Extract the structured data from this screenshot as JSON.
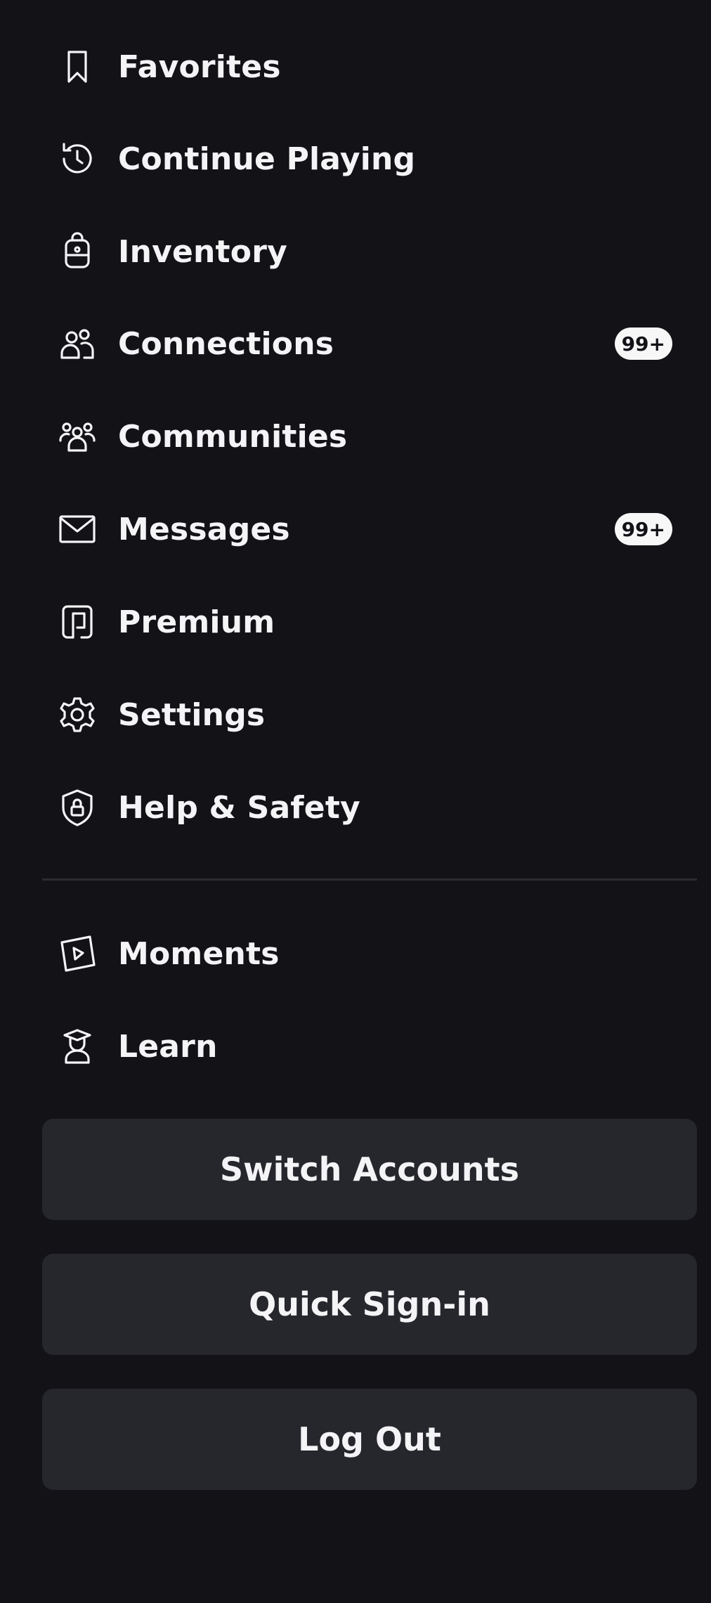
{
  "menu": {
    "items": [
      {
        "label": "Favorites",
        "icon": "bookmark-icon",
        "badge": ""
      },
      {
        "label": "Continue Playing",
        "icon": "history-icon",
        "badge": ""
      },
      {
        "label": "Inventory",
        "icon": "backpack-icon",
        "badge": ""
      },
      {
        "label": "Connections",
        "icon": "people-icon",
        "badge": "99+"
      },
      {
        "label": "Communities",
        "icon": "group-icon",
        "badge": ""
      },
      {
        "label": "Messages",
        "icon": "envelope-icon",
        "badge": "99+"
      },
      {
        "label": "Premium",
        "icon": "premium-icon",
        "badge": ""
      },
      {
        "label": "Settings",
        "icon": "gear-icon",
        "badge": ""
      },
      {
        "label": "Help & Safety",
        "icon": "shield-lock-icon",
        "badge": ""
      }
    ],
    "secondary_items": [
      {
        "label": "Moments",
        "icon": "play-card-icon"
      },
      {
        "label": "Learn",
        "icon": "graduate-icon"
      }
    ]
  },
  "buttons": {
    "switch_accounts": "Switch Accounts",
    "quick_sign_in": "Quick Sign-in",
    "log_out": "Log Out"
  },
  "colors": {
    "background": "#121217",
    "button_bg": "#26272c",
    "text": "#f4f4f6",
    "badge_bg": "#f7f7f8",
    "divider": "#2b2c31"
  }
}
